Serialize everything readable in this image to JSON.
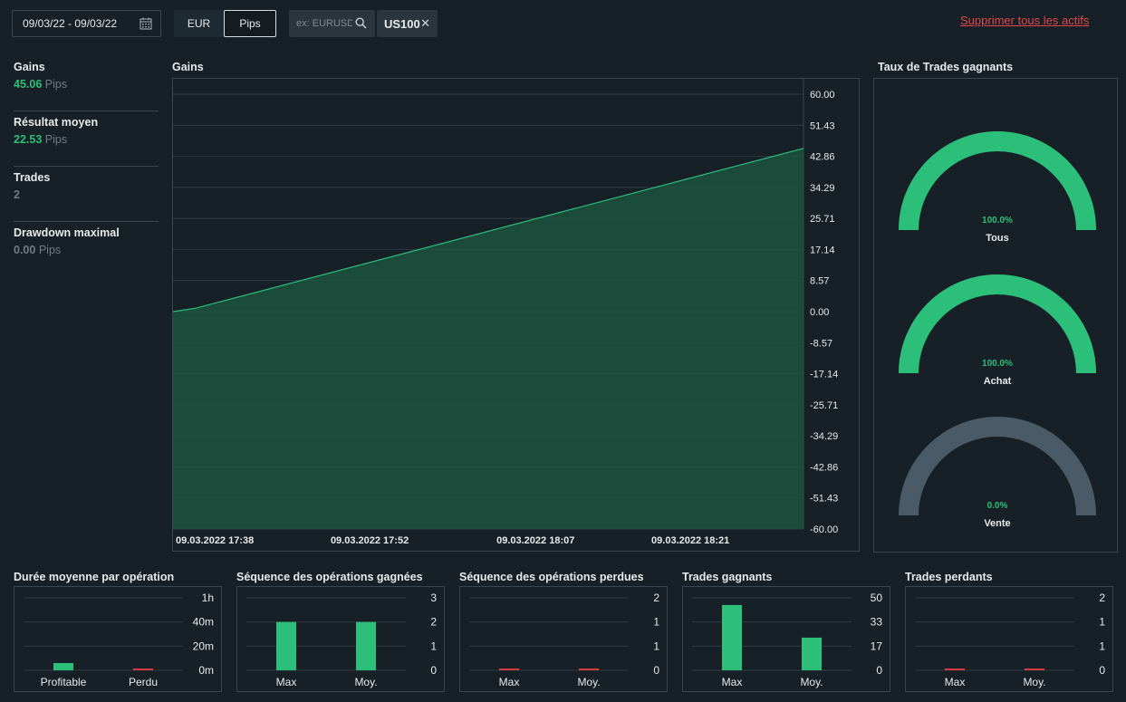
{
  "toolbar": {
    "date_range": "09/03/22 - 09/03/22",
    "currency_label": "EUR",
    "pips_label": "Pips",
    "search_placeholder": "ex: EURUSD",
    "asset_chip": "US100",
    "remove_all": "Supprimer tous les actifs"
  },
  "stats": [
    {
      "label": "Gains",
      "value": "45.06",
      "unit": "Pips",
      "color": "green"
    },
    {
      "label": "Résultat moyen",
      "value": "22.53",
      "unit": "Pips",
      "color": "green"
    },
    {
      "label": "Trades",
      "value": "2",
      "unit": "",
      "color": "grey"
    },
    {
      "label": "Drawdown maximal",
      "value": "0.00",
      "unit": "Pips",
      "color": "grey"
    }
  ],
  "main_chart_title": "Gains",
  "gauges_title": "Taux de Trades gagnants",
  "gauges": [
    {
      "label": "Tous",
      "percent_text": "100.0%",
      "value": 100
    },
    {
      "label": "Achat",
      "percent_text": "100.0%",
      "value": 100
    },
    {
      "label": "Vente",
      "percent_text": "0.0%",
      "value": 0
    }
  ],
  "colors": {
    "positive": "#2bbf7a",
    "negative": "#d23b3f",
    "neutral": "#4a5a66",
    "area": "#1d5a43"
  },
  "chart_data": [
    {
      "type": "area",
      "title": "Gains",
      "x_ticks": [
        "09.03.2022 17:38",
        "09.03.2022 17:52",
        "09.03.2022 18:07",
        "09.03.2022 18:21"
      ],
      "y_ticks": [
        "60.00",
        "51.43",
        "42.86",
        "34.29",
        "25.71",
        "17.14",
        "8.57",
        "0.00",
        "-8.57",
        "-17.14",
        "-25.71",
        "-34.29",
        "-42.86",
        "-51.43",
        "-60.00"
      ],
      "ylim": [
        -60,
        60
      ],
      "x": [
        "09.03.2022 17:38",
        "09.03.2022 17:40",
        "09.03.2022 18:35"
      ],
      "values": [
        0,
        0.9,
        45.06
      ]
    },
    {
      "type": "bar",
      "title": "Durée moyenne par opération",
      "categories": [
        "Profitable",
        "Perdu"
      ],
      "values": [
        6,
        1
      ],
      "y_ticks": [
        "1h",
        "40m",
        "20m",
        "0m"
      ],
      "ylim": [
        0,
        60
      ],
      "bar_colors": [
        "#2bbf7a",
        "#d23b3f"
      ]
    },
    {
      "type": "bar",
      "title": "Séquence des opérations gagnées",
      "categories": [
        "Max",
        "Moy."
      ],
      "values": [
        2,
        2
      ],
      "y_ticks": [
        "3",
        "2",
        "1",
        "0"
      ],
      "ylim": [
        0,
        3
      ],
      "bar_colors": [
        "#2bbf7a",
        "#2bbf7a"
      ]
    },
    {
      "type": "bar",
      "title": "Séquence des opérations perdues",
      "categories": [
        "Max",
        "Moy."
      ],
      "values": [
        0,
        0
      ],
      "y_ticks": [
        "2",
        "1",
        "1",
        "0"
      ],
      "ylim": [
        0,
        3
      ],
      "bar_colors": [
        "#d23b3f",
        "#d23b3f"
      ]
    },
    {
      "type": "bar",
      "title": "Trades gagnants",
      "categories": [
        "Max",
        "Moy."
      ],
      "values": [
        45.06,
        22.53
      ],
      "y_ticks": [
        "50",
        "33",
        "17",
        "0"
      ],
      "ylim": [
        0,
        50
      ],
      "bar_colors": [
        "#2bbf7a",
        "#2bbf7a"
      ]
    },
    {
      "type": "bar",
      "title": "Trades perdants",
      "categories": [
        "Max",
        "Moy."
      ],
      "values": [
        0,
        0
      ],
      "y_ticks": [
        "2",
        "1",
        "1",
        "0"
      ],
      "ylim": [
        0,
        3
      ],
      "bar_colors": [
        "#d23b3f",
        "#d23b3f"
      ]
    }
  ]
}
